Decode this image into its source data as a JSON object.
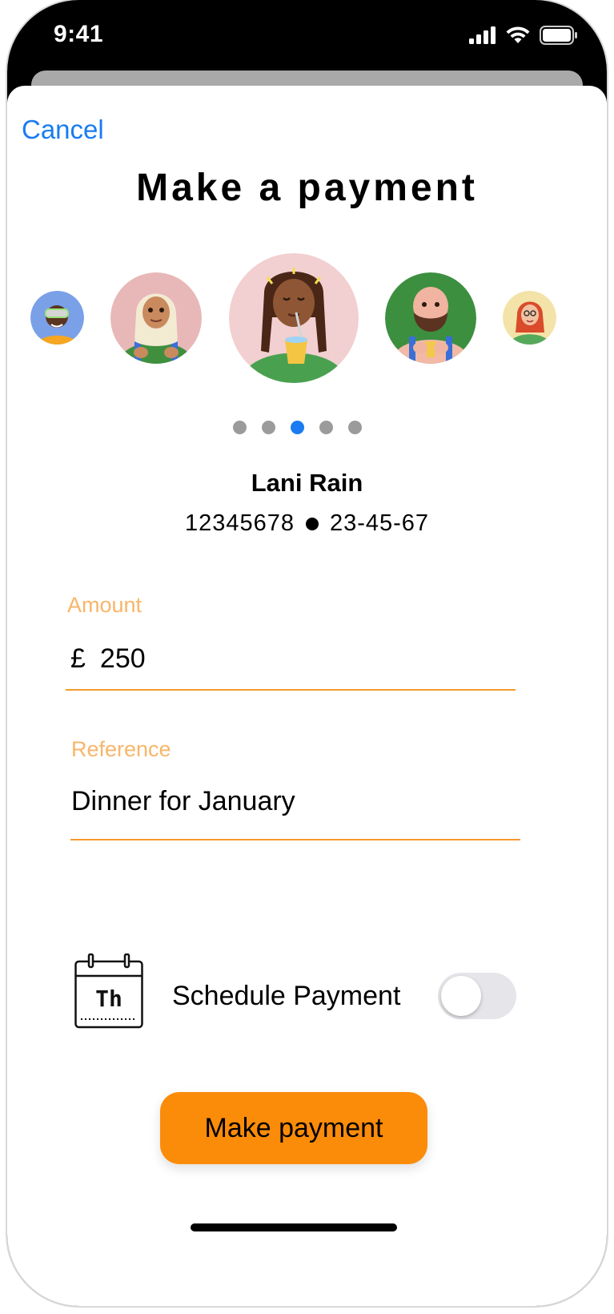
{
  "status_bar": {
    "time": "9:41"
  },
  "header": {
    "cancel_label": "Cancel",
    "title": "Make a payment"
  },
  "carousel": {
    "avatars": [
      "avatar-vr-headset-person",
      "avatar-hijab-person",
      "avatar-dreadlocks-person",
      "avatar-bearded-person",
      "avatar-red-hair-person"
    ],
    "dots_count": 5,
    "active_index": 2
  },
  "payee": {
    "name": "Lani Rain",
    "account_number": "12345678",
    "sort_code": "23-45-67"
  },
  "amount": {
    "label": "Amount",
    "currency_symbol": "£",
    "value": "250"
  },
  "reference": {
    "label": "Reference",
    "value": "Dinner for January"
  },
  "schedule": {
    "icon_text": "Th",
    "label": "Schedule Payment",
    "enabled": false
  },
  "actions": {
    "make_payment_label": "Make payment"
  },
  "colors": {
    "accent": "#fb8c0a",
    "link": "#1a7cf0",
    "label": "#f7b66a",
    "active_dot": "#1a7cf0",
    "inactive_dot": "#9b9b9b"
  }
}
